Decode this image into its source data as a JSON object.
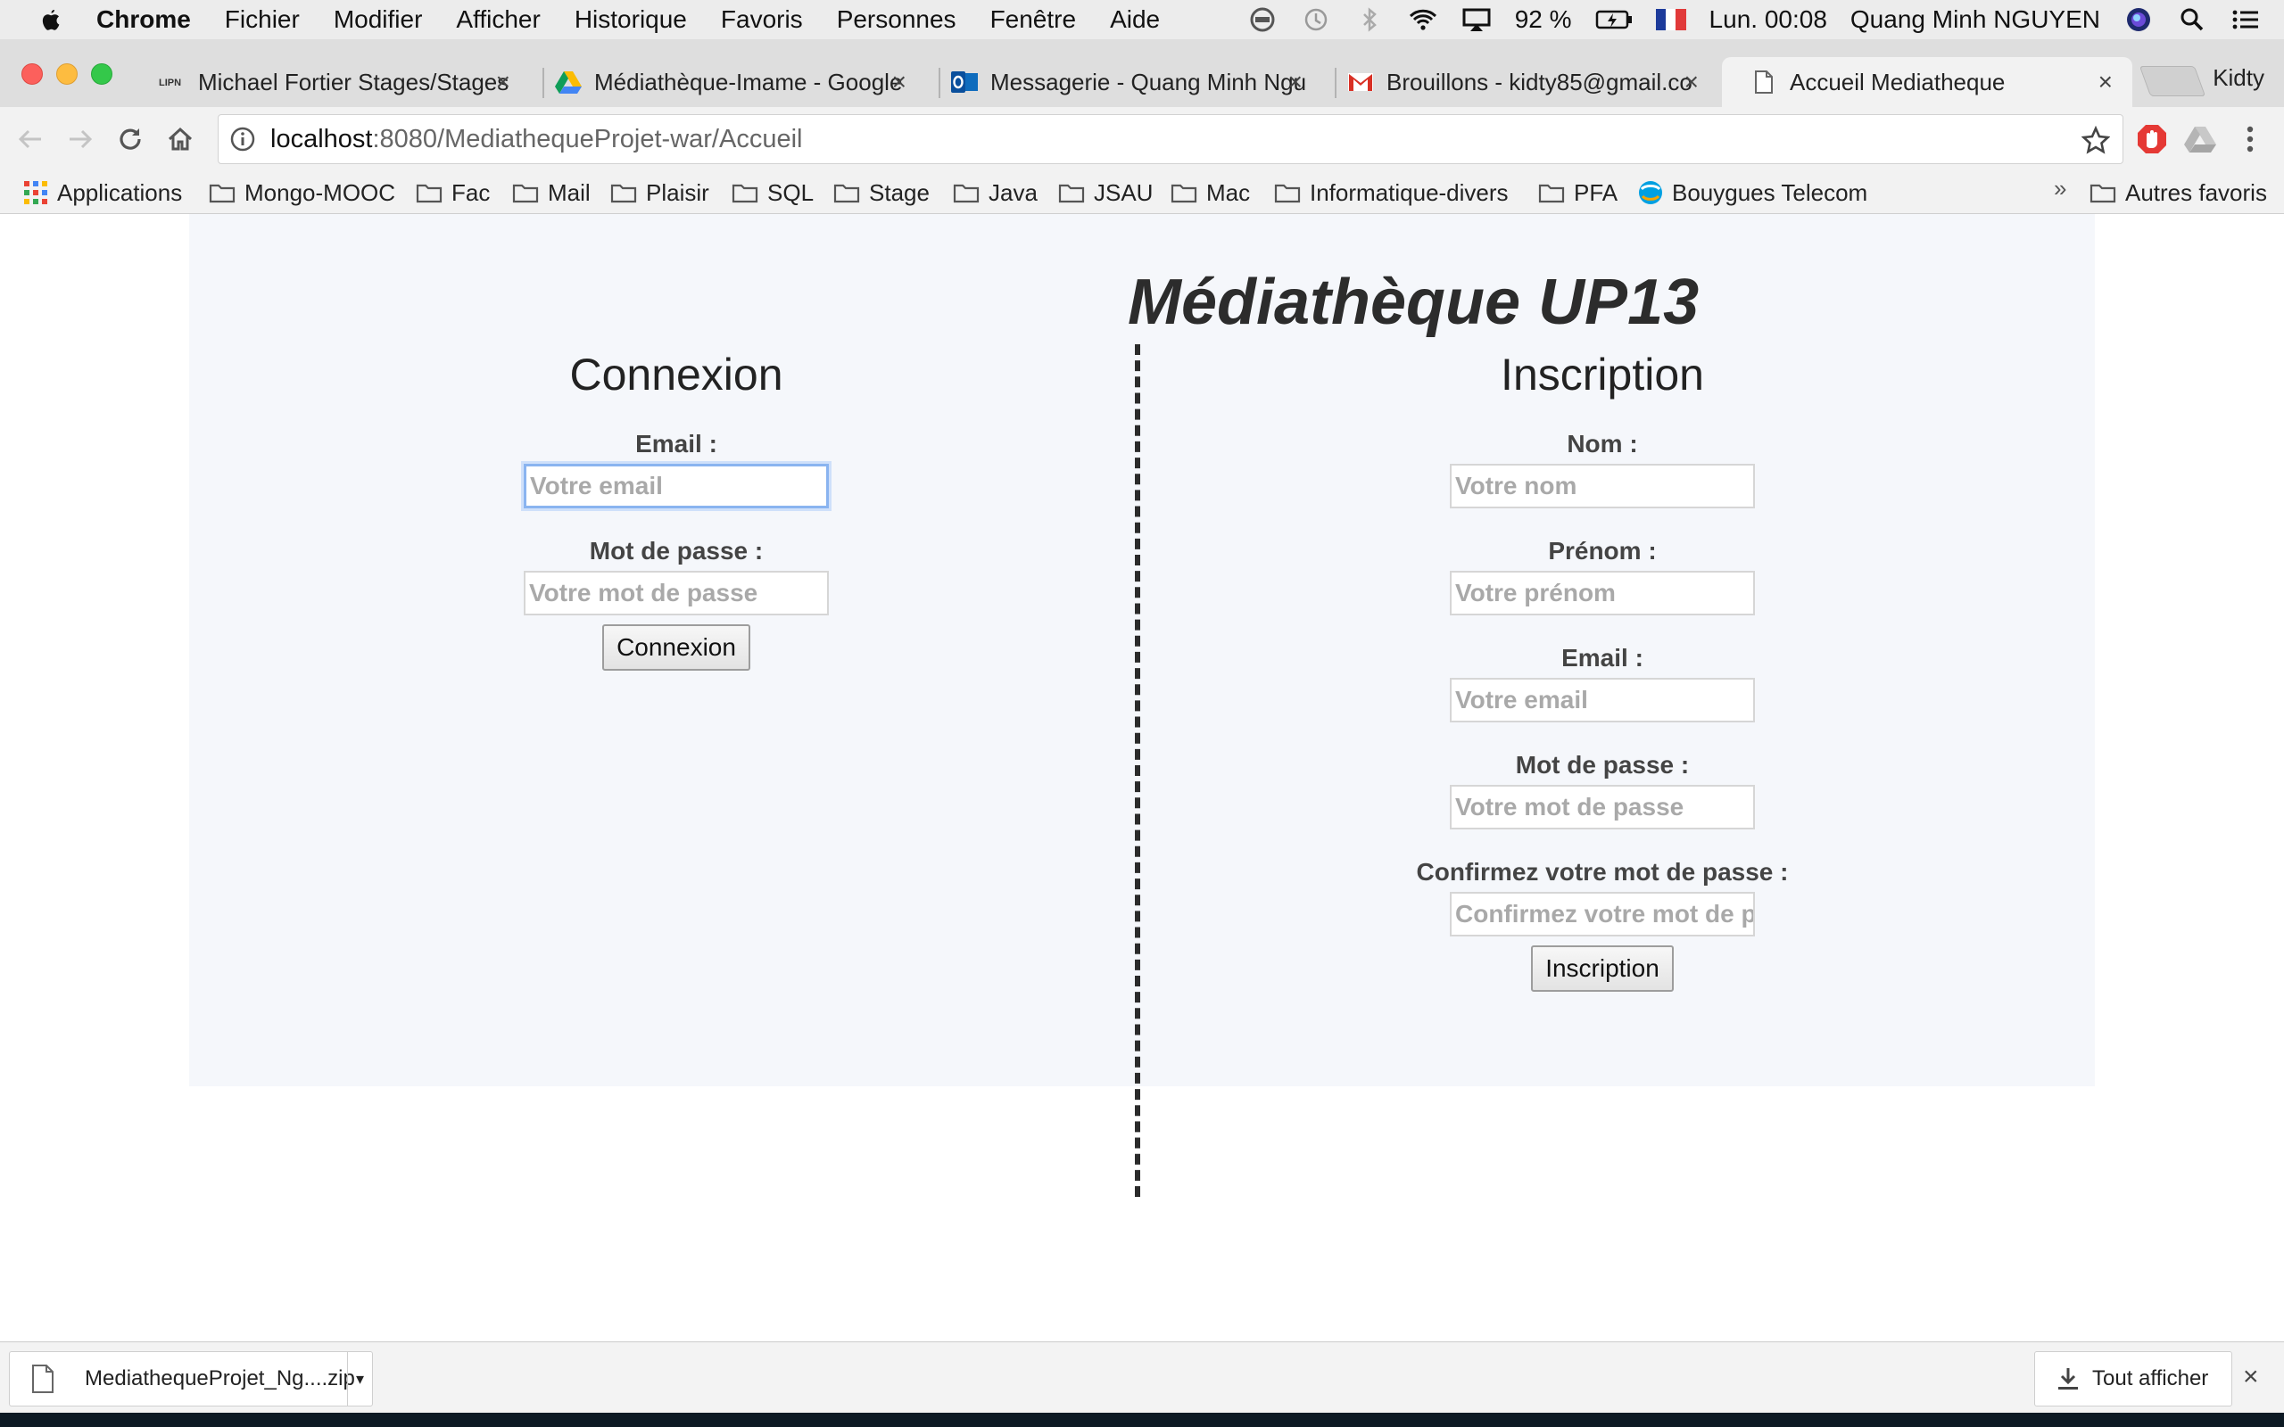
{
  "menubar": {
    "app_name": "Chrome",
    "menus": [
      "Fichier",
      "Modifier",
      "Afficher",
      "Historique",
      "Favoris",
      "Personnes",
      "Fenêtre",
      "Aide"
    ],
    "battery": "92 %",
    "clock": "Lun. 00:08",
    "user": "Quang Minh NGUYEN"
  },
  "tabs": [
    {
      "title": "Michael Fortier Stages/Stages",
      "favicon": "lipn-icon",
      "favicon_text": "LIPN"
    },
    {
      "title": "Médiathèque-Imame - Google",
      "favicon": "google-drive-icon"
    },
    {
      "title": "Messagerie - Quang Minh Ngu",
      "favicon": "outlook-icon"
    },
    {
      "title": "Brouillons - kidty85@gmail.co",
      "favicon": "gmail-icon"
    },
    {
      "title": "Accueil Mediatheque",
      "favicon": "page-icon"
    }
  ],
  "profile_name": "Kidty",
  "address_bar": {
    "host": "localhost",
    "path": ":8080/MediathequeProjet-war/Accueil"
  },
  "bookmarks": {
    "apps": "Applications",
    "folders": [
      "Mongo-MOOC",
      "Fac",
      "Mail",
      "Plaisir",
      "SQL",
      "Stage",
      "Java",
      "JSAU",
      "Mac",
      "Informatique-divers",
      "PFA"
    ],
    "bouygues": "Bouygues Telecom",
    "more": "»",
    "other": "Autres favoris"
  },
  "page": {
    "site_title": "Médiathèque UP13",
    "login": {
      "heading": "Connexion",
      "email_label": "Email :",
      "email_placeholder": "Votre email",
      "password_label": "Mot de passe :",
      "password_placeholder": "Votre mot de passe",
      "submit": "Connexion"
    },
    "signup": {
      "heading": "Inscription",
      "nom_label": "Nom :",
      "nom_placeholder": "Votre nom",
      "prenom_label": "Prénom :",
      "prenom_placeholder": "Votre prénom",
      "email_label": "Email :",
      "email_placeholder": "Votre email",
      "password_label": "Mot de passe :",
      "password_placeholder": "Votre mot de passe",
      "confirm_label": "Confirmez votre mot de passe :",
      "confirm_placeholder": "Confirmez votre mot de passe",
      "submit": "Inscription"
    }
  },
  "downloads": {
    "file_name": "MediathequeProjet_Ng....zip",
    "show_all": "Tout afficher"
  },
  "colors": {
    "accent_focus": "#8ab4f0",
    "panel_background": "#f5f7fb",
    "traffic_close": "#fc605c",
    "traffic_minimize": "#fdbc40",
    "traffic_zoom": "#34c84a"
  }
}
